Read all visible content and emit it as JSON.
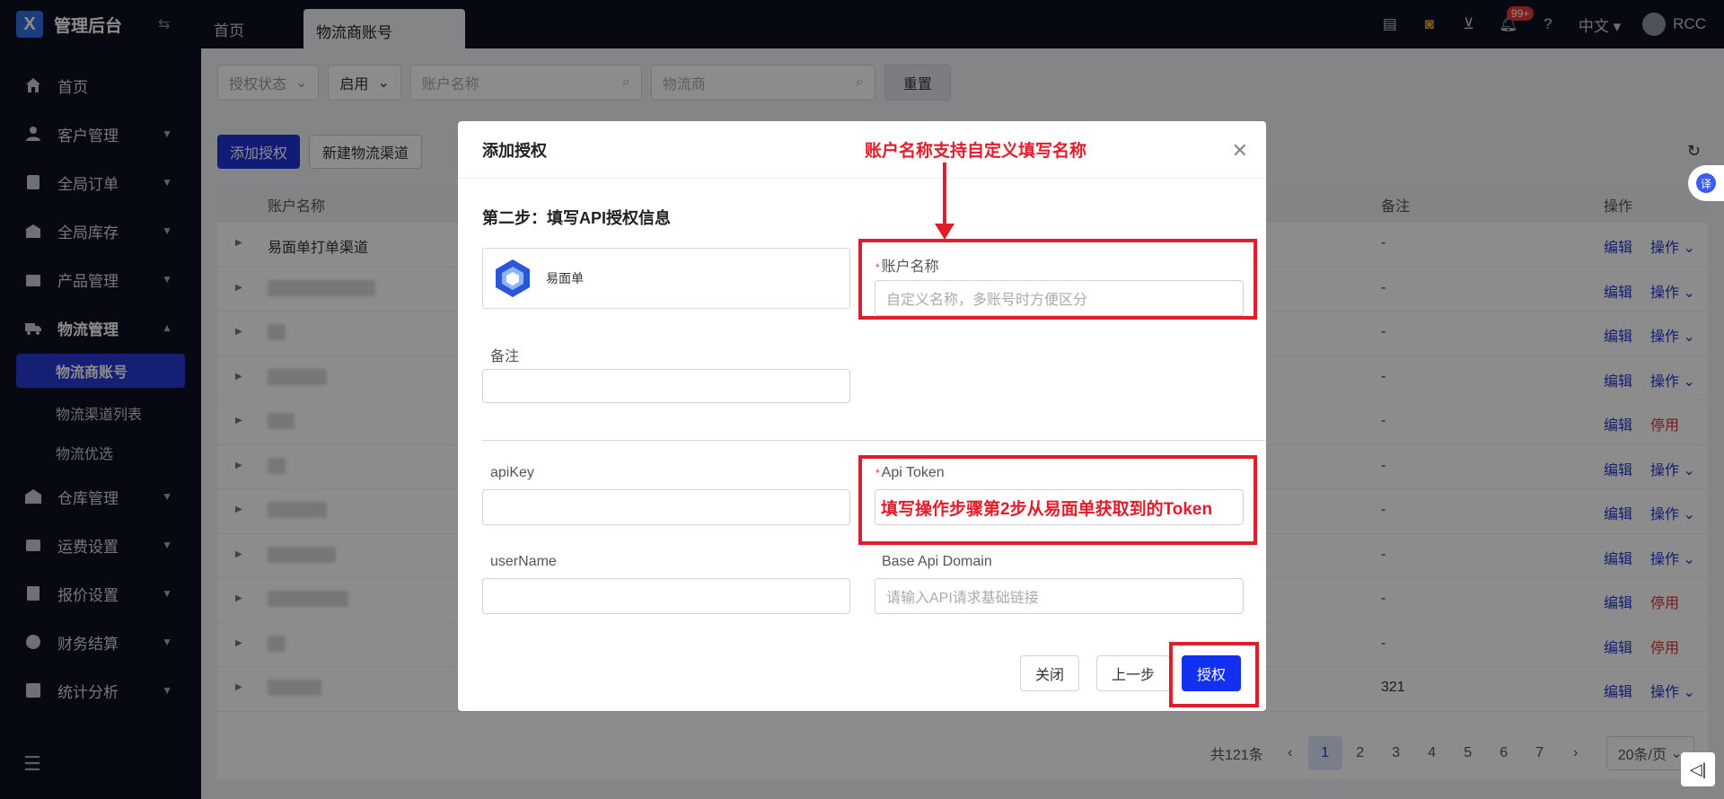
{
  "app": {
    "title": "管理后台",
    "logo_letter": "X"
  },
  "sidebar": {
    "items": [
      {
        "label": "首页",
        "icon": "home-icon"
      },
      {
        "label": "客户管理",
        "icon": "user-icon"
      },
      {
        "label": "全局订单",
        "icon": "order-icon"
      },
      {
        "label": "全局库存",
        "icon": "inventory-icon"
      },
      {
        "label": "产品管理",
        "icon": "product-icon"
      },
      {
        "label": "物流管理",
        "icon": "truck-icon"
      }
    ],
    "sub_items": [
      {
        "label": "物流商账号"
      },
      {
        "label": "物流渠道列表"
      },
      {
        "label": "物流优选"
      }
    ],
    "items_after": [
      {
        "label": "仓库管理",
        "icon": "warehouse-icon"
      },
      {
        "label": "运费设置",
        "icon": "freight-icon"
      },
      {
        "label": "报价设置",
        "icon": "quote-icon"
      },
      {
        "label": "财务结算",
        "icon": "finance-icon"
      },
      {
        "label": "统计分析",
        "icon": "chart-icon"
      }
    ]
  },
  "topbar": {
    "tabs": [
      {
        "label": "首页"
      },
      {
        "label": "物流商账号"
      }
    ],
    "badge": "99+",
    "language": "中文",
    "user": "RCC"
  },
  "filters": {
    "auth_status": "授权状态",
    "enabled": "启用",
    "account_placeholder": "账户名称",
    "provider_placeholder": "物流商",
    "reset": "重置"
  },
  "actions": {
    "add_auth": "添加授权",
    "new_channel": "新建物流渠道"
  },
  "table": {
    "headers": {
      "name": "账户名称",
      "note": "备注",
      "op": "操作"
    },
    "rows": [
      {
        "name": "易面单打单渠道",
        "note": "-",
        "edit": "编辑",
        "more": "操作",
        "stop": false
      },
      {
        "name": "",
        "note": "-",
        "edit": "编辑",
        "more": "操作",
        "stop": false
      },
      {
        "name": "",
        "note": "-",
        "edit": "编辑",
        "more": "操作",
        "stop": false
      },
      {
        "name": "",
        "note": "-",
        "edit": "编辑",
        "more": "操作",
        "stop": false
      },
      {
        "name": "",
        "note": "-",
        "edit": "编辑",
        "more": "停用",
        "stop": true
      },
      {
        "name": "",
        "note": "-",
        "edit": "编辑",
        "more": "操作",
        "stop": false
      },
      {
        "name": "",
        "note": "-",
        "edit": "编辑",
        "more": "操作",
        "stop": false
      },
      {
        "name": "",
        "note": "-",
        "edit": "编辑",
        "more": "操作",
        "stop": false
      },
      {
        "name": "",
        "note": "-",
        "edit": "编辑",
        "more": "停用",
        "stop": true
      },
      {
        "name": "",
        "note": "-",
        "edit": "编辑",
        "more": "停用",
        "stop": true
      },
      {
        "name": "",
        "note": "321",
        "edit": "编辑",
        "more": "操作",
        "stop": false
      }
    ]
  },
  "pagination": {
    "total": "共121条",
    "pages": [
      "1",
      "2",
      "3",
      "4",
      "5",
      "6",
      "7"
    ],
    "current": "1",
    "page_size": "20条/页"
  },
  "modal": {
    "title": "添加授权",
    "step_title": "第二步：填写API授权信息",
    "provider_name": "易面单",
    "annotation_top": "账户名称支持自定义填写名称",
    "account_label": "账户名称",
    "account_placeholder": "自定义名称，多账号时方便区分",
    "note_label": "备注",
    "apikey_label": "apiKey",
    "token_label": "Api Token",
    "token_annotation": "填写操作步骤第2步从易面单获取到的Token",
    "username_label": "userName",
    "domain_label": "Base Api Domain",
    "domain_placeholder": "请输入API请求基础链接",
    "btn_close": "关闭",
    "btn_prev": "上一步",
    "btn_auth": "授权"
  },
  "float": {
    "translate": "译"
  }
}
